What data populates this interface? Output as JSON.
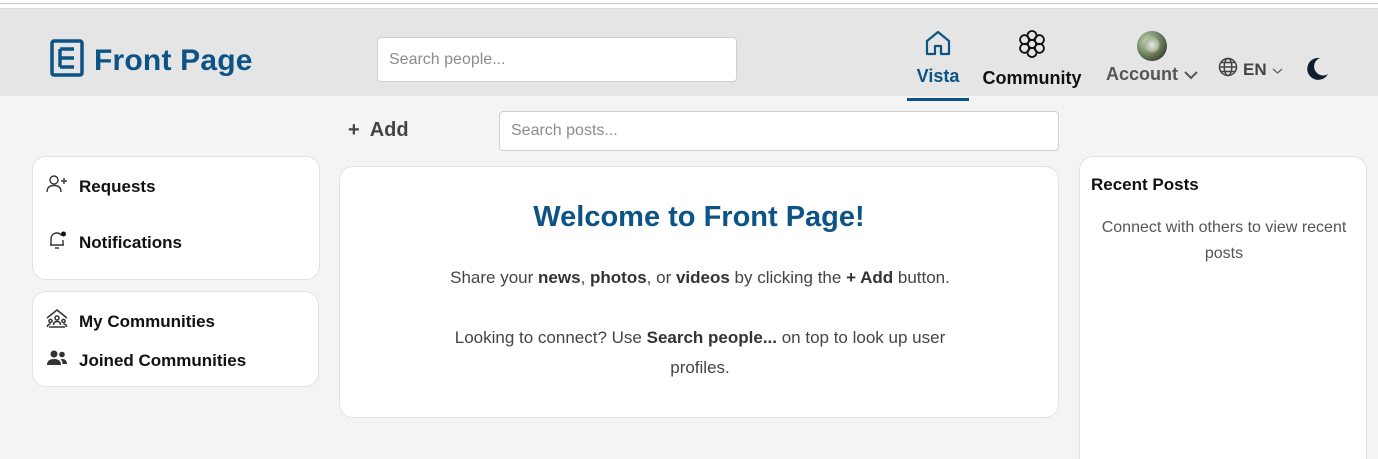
{
  "app": {
    "title": "Front Page",
    "brand_color": "#0d5486"
  },
  "header": {
    "search_people": {
      "placeholder": "Search people...",
      "value": ""
    },
    "nav": [
      {
        "label": "Vista",
        "icon": "home-icon",
        "active": true
      },
      {
        "label": "Community",
        "icon": "flower-icon",
        "active": false
      },
      {
        "label": "Account",
        "icon": "avatar",
        "active": false
      }
    ],
    "language": "EN"
  },
  "toolbar": {
    "add_label": "Add",
    "add_icon": "+",
    "search_posts": {
      "placeholder": "Search posts...",
      "value": ""
    }
  },
  "sidebar": {
    "group1": [
      {
        "label": "Requests",
        "icon": "add-user-icon"
      },
      {
        "label": "Notifications",
        "icon": "bell-icon"
      }
    ],
    "group2": [
      {
        "label": "My Communities",
        "icon": "community-house-icon"
      },
      {
        "label": "Joined Communities",
        "icon": "group-icon"
      }
    ]
  },
  "main": {
    "welcome_title": "Welcome to Front Page!",
    "line1": {
      "p1": "Share your ",
      "news": "news",
      "p2": ", ",
      "photos": "photos",
      "p3": ", or ",
      "videos": "videos",
      "p4": " by clicking the ",
      "add": "+ Add",
      "p5": " button."
    },
    "line2": {
      "p1": "Looking to connect? Use ",
      "search": "Search people...",
      "p2": " on top to look up user profiles."
    }
  },
  "recent_posts": {
    "title": "Recent Posts",
    "empty_text": "Connect with others to view recent posts"
  }
}
